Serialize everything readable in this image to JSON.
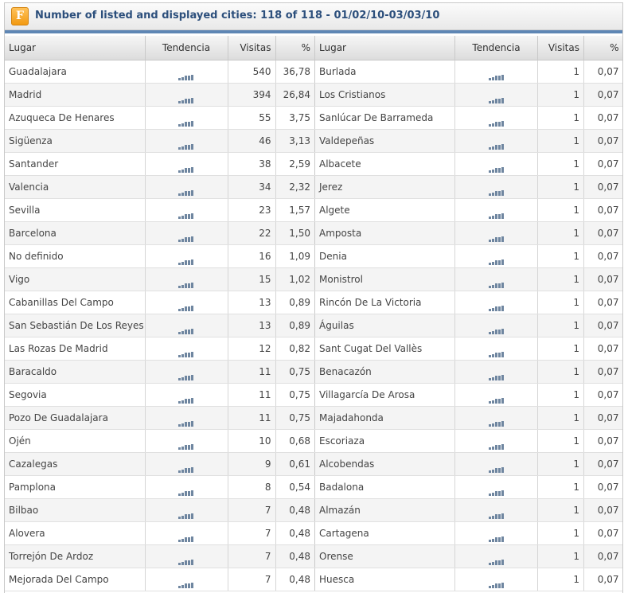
{
  "header": {
    "logo_letter": "F",
    "title": "Number of listed and displayed cities: 118 of 118 - 01/02/10-03/03/10"
  },
  "columns": {
    "lugar": "Lugar",
    "tendencia": "Tendencia",
    "visitas": "Visitas",
    "pct": "%"
  },
  "trend_icon": "bar-chart-icon",
  "colors": {
    "title": "#2c4f7c",
    "accent_bar": "#5e86b4",
    "logo": "#f29a12"
  },
  "left_rows": [
    {
      "lugar": "Guadalajara",
      "visitas": "540",
      "pct": "36,78"
    },
    {
      "lugar": "Madrid",
      "visitas": "394",
      "pct": "26,84"
    },
    {
      "lugar": "Azuqueca De Henares",
      "visitas": "55",
      "pct": "3,75"
    },
    {
      "lugar": "Sigüenza",
      "visitas": "46",
      "pct": "3,13"
    },
    {
      "lugar": "Santander",
      "visitas": "38",
      "pct": "2,59"
    },
    {
      "lugar": "Valencia",
      "visitas": "34",
      "pct": "2,32"
    },
    {
      "lugar": "Sevilla",
      "visitas": "23",
      "pct": "1,57"
    },
    {
      "lugar": "Barcelona",
      "visitas": "22",
      "pct": "1,50"
    },
    {
      "lugar": "No definido",
      "visitas": "16",
      "pct": "1,09"
    },
    {
      "lugar": "Vigo",
      "visitas": "15",
      "pct": "1,02"
    },
    {
      "lugar": "Cabanillas Del Campo",
      "visitas": "13",
      "pct": "0,89"
    },
    {
      "lugar": "San Sebastián De Los Reyes",
      "visitas": "13",
      "pct": "0,89"
    },
    {
      "lugar": "Las Rozas De Madrid",
      "visitas": "12",
      "pct": "0,82"
    },
    {
      "lugar": "Baracaldo",
      "visitas": "11",
      "pct": "0,75"
    },
    {
      "lugar": "Segovia",
      "visitas": "11",
      "pct": "0,75"
    },
    {
      "lugar": "Pozo De Guadalajara",
      "visitas": "11",
      "pct": "0,75"
    },
    {
      "lugar": "Ojén",
      "visitas": "10",
      "pct": "0,68"
    },
    {
      "lugar": "Cazalegas",
      "visitas": "9",
      "pct": "0,61"
    },
    {
      "lugar": "Pamplona",
      "visitas": "8",
      "pct": "0,54"
    },
    {
      "lugar": "Bilbao",
      "visitas": "7",
      "pct": "0,48"
    },
    {
      "lugar": "Alovera",
      "visitas": "7",
      "pct": "0,48"
    },
    {
      "lugar": "Torrejón De Ardoz",
      "visitas": "7",
      "pct": "0,48"
    },
    {
      "lugar": "Mejorada Del Campo",
      "visitas": "7",
      "pct": "0,48"
    }
  ],
  "right_rows": [
    {
      "lugar": "Burlada",
      "visitas": "1",
      "pct": "0,07"
    },
    {
      "lugar": "Los Cristianos",
      "visitas": "1",
      "pct": "0,07"
    },
    {
      "lugar": "Sanlúcar De Barrameda",
      "visitas": "1",
      "pct": "0,07"
    },
    {
      "lugar": "Valdepeñas",
      "visitas": "1",
      "pct": "0,07"
    },
    {
      "lugar": "Albacete",
      "visitas": "1",
      "pct": "0,07"
    },
    {
      "lugar": "Jerez",
      "visitas": "1",
      "pct": "0,07"
    },
    {
      "lugar": "Algete",
      "visitas": "1",
      "pct": "0,07"
    },
    {
      "lugar": "Amposta",
      "visitas": "1",
      "pct": "0,07"
    },
    {
      "lugar": "Denia",
      "visitas": "1",
      "pct": "0,07"
    },
    {
      "lugar": "Monistrol",
      "visitas": "1",
      "pct": "0,07"
    },
    {
      "lugar": "Rincón De La Victoria",
      "visitas": "1",
      "pct": "0,07"
    },
    {
      "lugar": "Águilas",
      "visitas": "1",
      "pct": "0,07"
    },
    {
      "lugar": "Sant Cugat Del Vallès",
      "visitas": "1",
      "pct": "0,07"
    },
    {
      "lugar": "Benacazón",
      "visitas": "1",
      "pct": "0,07"
    },
    {
      "lugar": "Villagarcía De Arosa",
      "visitas": "1",
      "pct": "0,07"
    },
    {
      "lugar": "Majadahonda",
      "visitas": "1",
      "pct": "0,07"
    },
    {
      "lugar": "Escoriaza",
      "visitas": "1",
      "pct": "0,07"
    },
    {
      "lugar": "Alcobendas",
      "visitas": "1",
      "pct": "0,07"
    },
    {
      "lugar": "Badalona",
      "visitas": "1",
      "pct": "0,07"
    },
    {
      "lugar": "Almazán",
      "visitas": "1",
      "pct": "0,07"
    },
    {
      "lugar": "Cartagena",
      "visitas": "1",
      "pct": "0,07"
    },
    {
      "lugar": "Orense",
      "visitas": "1",
      "pct": "0,07"
    },
    {
      "lugar": "Huesca",
      "visitas": "1",
      "pct": "0,07"
    }
  ]
}
